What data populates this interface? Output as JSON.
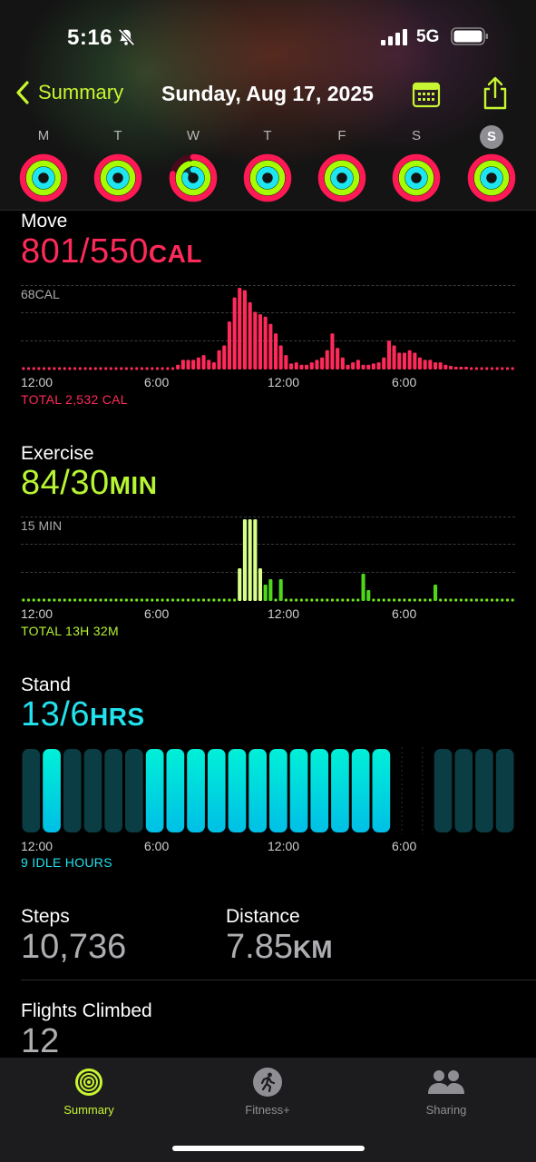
{
  "status": {
    "time": "5:16",
    "network": "5G"
  },
  "nav": {
    "back_label": "Summary",
    "title": "Sunday, Aug 17, 2025"
  },
  "week": [
    {
      "label": "M",
      "selected": false
    },
    {
      "label": "T",
      "selected": false
    },
    {
      "label": "W",
      "selected": false
    },
    {
      "label": "T",
      "selected": false
    },
    {
      "label": "F",
      "selected": false
    },
    {
      "label": "S",
      "selected": false
    },
    {
      "label": "S",
      "selected": true
    }
  ],
  "move": {
    "title": "Move",
    "value": "801/550",
    "unit": "CAL",
    "max_label": "68CAL",
    "total": "TOTAL 2,532 CAL",
    "color": "#ff2a5a"
  },
  "exercise": {
    "title": "Exercise",
    "value": "84/30",
    "unit": "MIN",
    "max_label": "15 MIN",
    "total": "TOTAL 13H 32M",
    "color": "#b7f533"
  },
  "stand": {
    "title": "Stand",
    "value": "13/6",
    "unit": "HRS",
    "total": "9 IDLE HOURS",
    "color": "#22e2ee"
  },
  "x_labels": [
    "12:00",
    "6:00",
    "12:00",
    "6:00"
  ],
  "steps": {
    "label": "Steps",
    "value": "10,736"
  },
  "distance": {
    "label": "Distance",
    "value": "7.85",
    "unit": "KM"
  },
  "flights": {
    "label": "Flights Climbed",
    "value": "12"
  },
  "tabs": [
    {
      "label": "Summary",
      "icon": "activity-rings-icon",
      "active": true
    },
    {
      "label": "Fitness+",
      "icon": "runner-icon",
      "active": false
    },
    {
      "label": "Sharing",
      "icon": "people-icon",
      "active": false
    }
  ],
  "chart_data": [
    {
      "type": "bar",
      "name": "move",
      "unit": "CAL per 15 min",
      "ylim": [
        0,
        68
      ],
      "x_start": "12:00",
      "bucket_minutes": 15,
      "values": [
        1,
        1,
        1,
        1,
        1,
        1,
        1,
        1,
        1,
        1,
        1,
        1,
        1,
        1,
        1,
        1,
        1,
        1,
        1,
        1,
        1,
        1,
        1,
        1,
        1,
        1,
        1,
        1,
        1,
        1,
        4,
        8,
        8,
        8,
        10,
        12,
        8,
        6,
        16,
        20,
        40,
        60,
        68,
        66,
        56,
        48,
        46,
        44,
        38,
        30,
        20,
        12,
        5,
        6,
        4,
        4,
        6,
        8,
        10,
        16,
        30,
        18,
        10,
        4,
        6,
        8,
        4,
        4,
        5,
        6,
        10,
        24,
        20,
        14,
        14,
        16,
        14,
        10,
        8,
        8,
        6,
        6,
        4,
        3,
        2,
        2,
        2,
        1,
        1,
        1,
        1,
        1,
        1,
        1,
        1,
        1
      ]
    },
    {
      "type": "bar",
      "name": "exercise",
      "unit": "MIN per 15 min",
      "ylim": [
        0,
        15
      ],
      "x_start": "12:00",
      "bucket_minutes": 15,
      "values": [
        0,
        0,
        0,
        0,
        0,
        0,
        0,
        0,
        0,
        0,
        0,
        0,
        0,
        0,
        1,
        0,
        0,
        0,
        0,
        0,
        0,
        0,
        0,
        0,
        0,
        0,
        0,
        0,
        0,
        0,
        0,
        0,
        1,
        0,
        0,
        0,
        0,
        0,
        0,
        0,
        0,
        0,
        6,
        15,
        15,
        15,
        6,
        3,
        4,
        1,
        4,
        1,
        0,
        0,
        0,
        0,
        0,
        1,
        0,
        0,
        0,
        0,
        0,
        0,
        0,
        0,
        5,
        2,
        0,
        0,
        0,
        0,
        0,
        0,
        0,
        0,
        0,
        1,
        1,
        1,
        3,
        0,
        0,
        0,
        0,
        0,
        0,
        0,
        0,
        0,
        0,
        0,
        0,
        0,
        0,
        0
      ]
    },
    {
      "type": "bar",
      "name": "stand",
      "unit": "hour status (2 = active, 1 = inactive, 0 = none)",
      "x_start": "12:00",
      "bucket_minutes": 60,
      "values": [
        1,
        2,
        1,
        1,
        1,
        1,
        2,
        2,
        2,
        2,
        2,
        2,
        2,
        2,
        2,
        2,
        2,
        2,
        0,
        0,
        1,
        1,
        1,
        1
      ]
    }
  ]
}
